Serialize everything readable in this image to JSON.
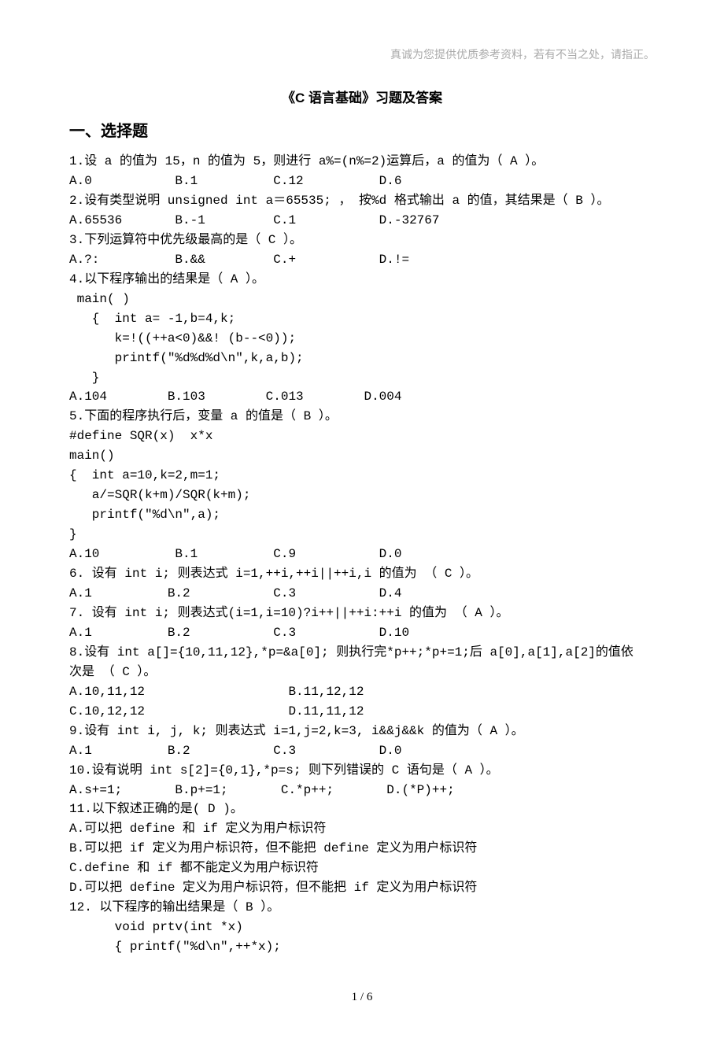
{
  "header_note": "真诚为您提供优质参考资料，若有不当之处，请指正。",
  "title": "《C 语言基础》习题及答案",
  "section_heading": "一、选择题",
  "lines": [
    "1.设 a 的值为 15，n 的值为 5，则进行 a%=(n%=2)运算后，a 的值为（ A ）。",
    "A.0           B.1          C.12          D.6",
    "2.设有类型说明 unsigned int a＝65535; ， 按%d 格式输出 a 的值，其结果是（ B ）。",
    "A.65536       B.-1         C.1           D.-32767",
    "3.下列运算符中优先级最高的是（ C ）。",
    "A.?:          B.&&         C.+           D.!=",
    "4.以下程序输出的结果是（ A ）。",
    " main( )",
    "   {  int a= -1,b=4,k;",
    "      k=!((++a<0)&&! (b--<0));",
    "      printf(\"%d%d%d\\n\",k,a,b);",
    "   }",
    "A.104        B.103        C.013        D.004",
    "5.下面的程序执行后，变量 a 的值是（ B ）。",
    "#define SQR(x)  x*x",
    "main()",
    "{  int a=10,k=2,m=1;",
    "   a/=SQR(k+m)/SQR(k+m);",
    "   printf(\"%d\\n\",a);",
    "}",
    "A.10          B.1          C.9           D.0",
    "6. 设有 int i; 则表达式 i=1,++i,++i||++i,i 的值为 （ C ）。",
    "A.1          B.2           C.3           D.4",
    "7. 设有 int i; 则表达式(i=1,i=10)?i++||++i:++i 的值为 （ A ）。",
    "A.1          B.2           C.3           D.10",
    "8.设有 int a[]={10,11,12},*p=&a[0]; 则执行完*p++;*p+=1;后 a[0],a[1],a[2]的值依",
    "次是 （ C ）。",
    "A.10,11,12                   B.11,12,12",
    "C.10,12,12                   D.11,11,12",
    "9.设有 int i, j, k; 则表达式 i=1,j=2,k=3, i&&j&&k 的值为（ A ）。",
    "A.1          B.2           C.3           D.0",
    "10.设有说明 int s[2]={0,1},*p=s; 则下列错误的 C 语句是（ A ）。",
    "A.s+=1;       B.p+=1;       C.*p++;       D.(*P)++;",
    "11.以下叙述正确的是( D )。",
    "A.可以把 define 和 if 定义为用户标识符",
    "B.可以把 if 定义为用户标识符，但不能把 define 定义为用户标识符",
    "C.define 和 if 都不能定义为用户标识符",
    "D.可以把 define 定义为用户标识符，但不能把 if 定义为用户标识符",
    "12. 以下程序的输出结果是（ B ）。",
    "      void prtv(int *x)",
    "      { printf(\"%d\\n\",++*x);"
  ],
  "page_number": "1 / 6"
}
